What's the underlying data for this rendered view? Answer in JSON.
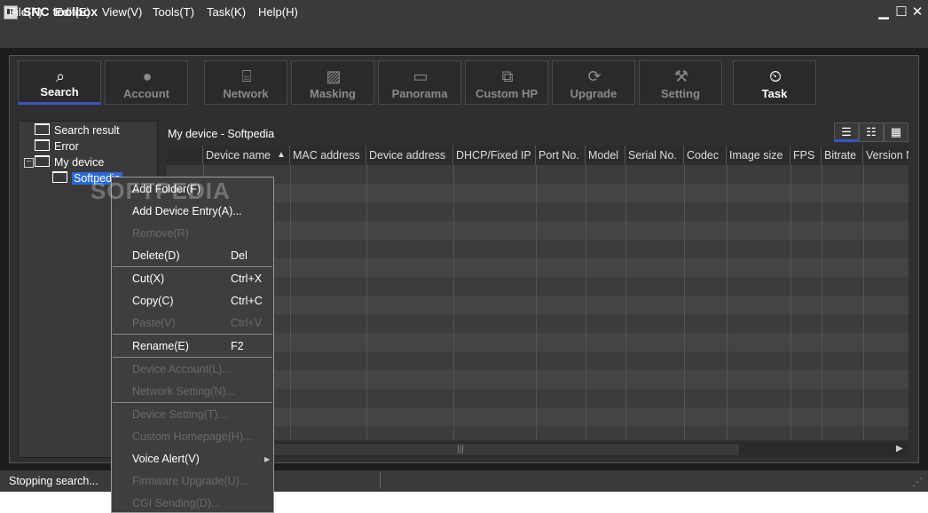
{
  "window": {
    "title": "SNC toolbox",
    "minimize": "▁",
    "maximize": "☐",
    "close": "✕"
  },
  "menubar": [
    "File(F)",
    "Edit(E)",
    "View(V)",
    "Tools(T)",
    "Task(K)",
    "Help(H)"
  ],
  "toolbar": [
    {
      "label": "Search",
      "icon": "search-icon",
      "glyph": "⌕"
    },
    {
      "label": "Account",
      "icon": "user-icon",
      "glyph": "●"
    },
    {
      "label": "Network",
      "icon": "network-icon",
      "glyph": "⌸"
    },
    {
      "label": "Masking",
      "icon": "masking-icon",
      "glyph": "▨"
    },
    {
      "label": "Panorama",
      "icon": "panorama-icon",
      "glyph": "▭"
    },
    {
      "label": "Custom HP",
      "icon": "custom-hp-icon",
      "glyph": "⧉"
    },
    {
      "label": "Upgrade",
      "icon": "upgrade-icon",
      "glyph": "⟳"
    },
    {
      "label": "Setting",
      "icon": "wrench-icon",
      "glyph": "⚒"
    },
    {
      "label": "Task",
      "icon": "clock-gear-icon",
      "glyph": "⏲"
    }
  ],
  "tree": {
    "items": [
      "Search result",
      "Error",
      "My device",
      "Softpedia"
    ],
    "expander": "−"
  },
  "device_list": {
    "title": "My device - Softpedia",
    "columns": [
      "",
      "Device name",
      "MAC address",
      "Device address",
      "DHCP/Fixed IP",
      "Port No.",
      "Model",
      "Serial No.",
      "Codec",
      "Image size",
      "FPS",
      "Bitrate",
      "Version N"
    ],
    "sort_indicator": "▲",
    "view_icons": [
      "☰",
      "☷",
      "▦"
    ]
  },
  "scrollbar": {
    "grip": "|||",
    "arrow": "▶"
  },
  "status": {
    "text": "Stopping search...",
    "grip": "⋰"
  },
  "watermark": "SOFTPEDIA",
  "context_menu": [
    {
      "label": "Add Folder(F)",
      "shortcut": "",
      "enabled": true
    },
    {
      "label": "Add Device Entry(A)...",
      "shortcut": "",
      "enabled": true
    },
    {
      "label": "Remove(R)",
      "shortcut": "",
      "enabled": false
    },
    {
      "label": "Delete(D)",
      "shortcut": "Del",
      "enabled": true
    },
    {
      "label": "Cut(X)",
      "shortcut": "Ctrl+X",
      "enabled": true
    },
    {
      "label": "Copy(C)",
      "shortcut": "Ctrl+C",
      "enabled": true
    },
    {
      "label": "Paste(V)",
      "shortcut": "Ctrl+V",
      "enabled": false
    },
    {
      "label": "Rename(E)",
      "shortcut": "F2",
      "enabled": true
    },
    {
      "label": "Device Account(L)...",
      "shortcut": "",
      "enabled": false
    },
    {
      "label": "Network Setting(N)...",
      "shortcut": "",
      "enabled": false
    },
    {
      "label": "Device Setting(T)...",
      "shortcut": "",
      "enabled": false
    },
    {
      "label": "Custom Homepage(H)...",
      "shortcut": "",
      "enabled": false
    },
    {
      "label": "Voice Alert(V)",
      "shortcut": "",
      "enabled": true
    },
    {
      "label": "Firmware Upgrade(U)...",
      "shortcut": "",
      "enabled": false
    },
    {
      "label": "CGI Sending(D)...",
      "shortcut": "",
      "enabled": false
    }
  ],
  "colors": {
    "accent": "#3c54c8",
    "selection": "#2a6ad8",
    "background": "#2f2f2f"
  }
}
